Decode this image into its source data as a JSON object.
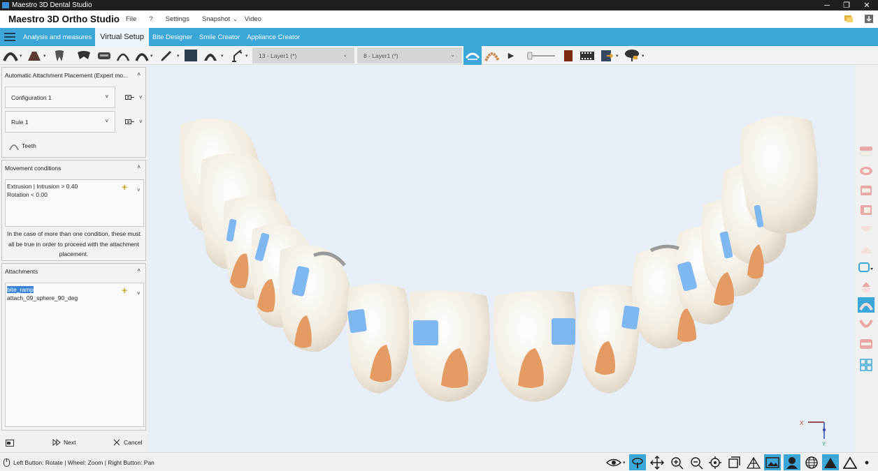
{
  "window": {
    "title": "Maestro 3D Dental Studio",
    "minimize": "─",
    "restore": "❐",
    "close": "✕"
  },
  "menu": {
    "brand": "Maestro 3D Ortho Studio",
    "items": [
      "File",
      "?",
      "Settings",
      "Snapshot",
      "Video"
    ],
    "snapshot_caret": "⌄"
  },
  "tabs": [
    {
      "label": "Analysis and measures",
      "active": false
    },
    {
      "label": "Virtual Setup",
      "active": true
    },
    {
      "label": "Bite Designer",
      "active": false
    },
    {
      "label": "Smile Creator",
      "active": false
    },
    {
      "label": "Appliance Creator",
      "active": false
    }
  ],
  "toolbar": {
    "layer_upper": "13 - Layer1 (*)",
    "layer_lower": "8 - Layer1 (*)",
    "play_icon": "▶"
  },
  "panel": {
    "attachment_section_title": "Automatic Attachment Placement (Expert mo...",
    "configuration_value": "Configuration 1",
    "rule_value": "Rule 1",
    "teeth_label": "Teeth",
    "movement_title": "Movement conditions",
    "conditions": [
      "Extrusion | Intrusion > 0.40",
      "Rotation < 0.00"
    ],
    "note_lines": [
      "In the case of more than one condition, these must",
      "all be true in order to proceed with the attachment",
      "placement."
    ],
    "attachments_title": "Attachments",
    "attachments": [
      "bite_ramp",
      "attach_09_sphere_90_deg"
    ],
    "next_label": "Next",
    "cancel_label": "Cancel",
    "collapse_glyph": "˄",
    "dropdown_glyph": "˅",
    "plus_glyph": "+"
  },
  "status": {
    "hint": "Left Button: Rotate | Wheel: Zoom | Right Button: Pan"
  },
  "axes": {
    "x": "X",
    "y": "Y"
  },
  "colors": {
    "accent": "#3ba7d9",
    "tooth": "#f4efe4",
    "attachment": "#7fb8f0",
    "ramp": "#e39a63"
  }
}
